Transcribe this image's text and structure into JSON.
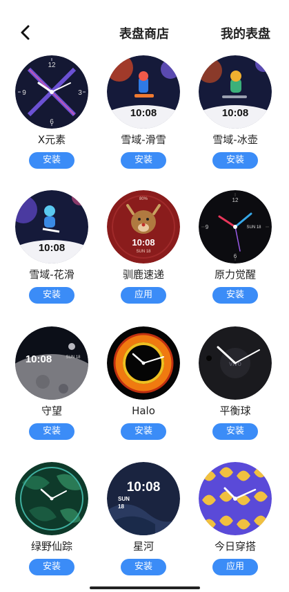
{
  "header": {
    "tab_store": "表盘商店",
    "tab_mine": "我的表盘",
    "back_icon": "chevron-left-icon"
  },
  "faces": [
    {
      "name": "X元素",
      "button": "安装",
      "clock": {
        "top": "12",
        "left": "9",
        "right": "3",
        "bottom": "6"
      }
    },
    {
      "name": "雪域-滑雪",
      "button": "安装",
      "time": "10:08"
    },
    {
      "name": "雪域-冰壶",
      "button": "安装",
      "time": "10:08"
    },
    {
      "name": "雪域-花滑",
      "button": "安装",
      "time": "10:08"
    },
    {
      "name": "驯鹿速递",
      "button": "应用",
      "time": "10:08",
      "date": "SUN 18",
      "battery": "80%"
    },
    {
      "name": "原力觉醒",
      "button": "安装",
      "clock": {
        "top": "12",
        "left": "9",
        "bottom": "6",
        "date": "SUN 18"
      }
    },
    {
      "name": "守望",
      "button": "安装",
      "time": "10:08",
      "date": "SUN 18"
    },
    {
      "name": "Halo",
      "button": "安装"
    },
    {
      "name": "平衡球",
      "button": "安装",
      "brand": "vivo"
    },
    {
      "name": "绿野仙踪",
      "button": "安装"
    },
    {
      "name": "星河",
      "button": "安装",
      "time": "10:08",
      "day": "SUN",
      "daynum": "18"
    },
    {
      "name": "今日穿搭",
      "button": "应用"
    }
  ],
  "colors": {
    "button_bg": "#3b8cf7",
    "button_text": "#ffffff"
  }
}
